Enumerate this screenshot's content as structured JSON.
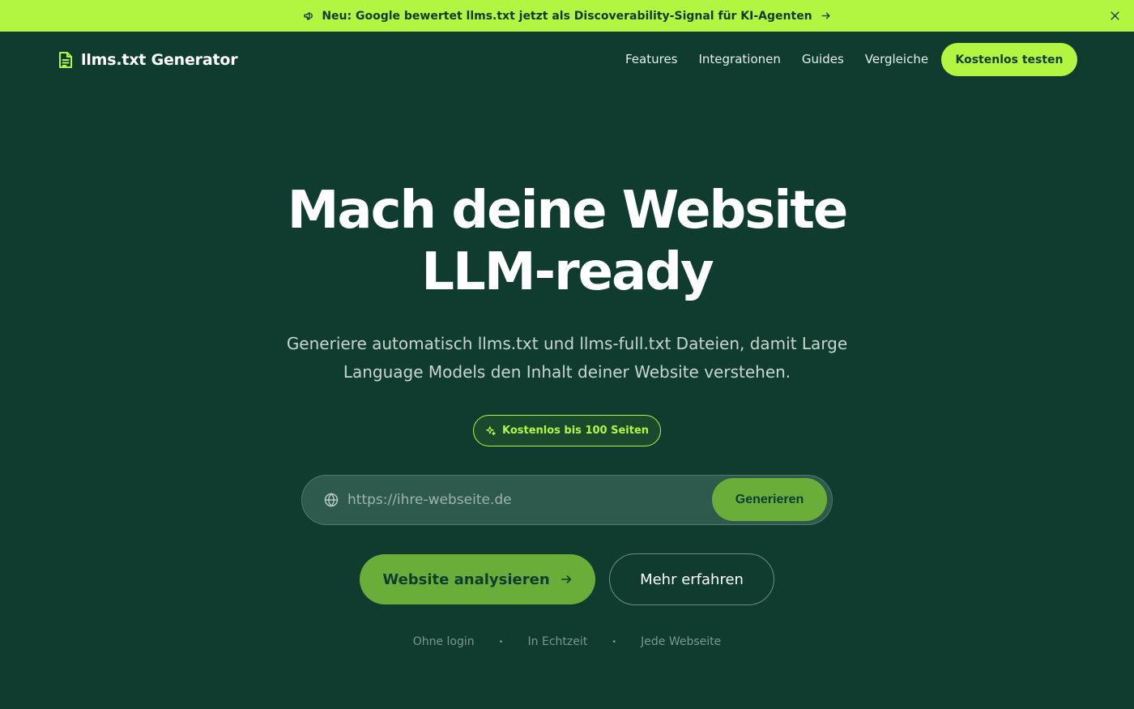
{
  "announcement": {
    "text": "Neu: Google bewertet llms.txt jetzt als Discoverability-Signal für KI-Agenten",
    "icon": "megaphone-icon",
    "close_icon": "close-icon"
  },
  "header": {
    "logo_text": "llms.txt Generator",
    "nav": [
      "Features",
      "Integrationen",
      "Guides",
      "Vergleiche"
    ],
    "cta": "Kostenlos testen"
  },
  "hero": {
    "title_line1": "Mach deine Website",
    "title_line2": "LLM-ready",
    "subtitle_line1": "Generiere automatisch llms.txt und llms-full.txt Dateien, damit Large",
    "subtitle_line2": "Language Models den Inhalt deiner Website verstehen.",
    "badge": "Kostenlos bis 100 Seiten"
  },
  "form": {
    "placeholder": "https://ihre-webseite.de",
    "value": "",
    "submit": "Generieren"
  },
  "actions": {
    "primary": "Website analysieren",
    "secondary": "Mehr erfahren"
  },
  "features": [
    "Ohne login",
    "In Echtzeit",
    "Jede Webseite"
  ],
  "colors": {
    "background": "#103c30",
    "accent": "#b3f641",
    "button_green": "#6aae39",
    "input_bg": "#2d5a4c"
  }
}
